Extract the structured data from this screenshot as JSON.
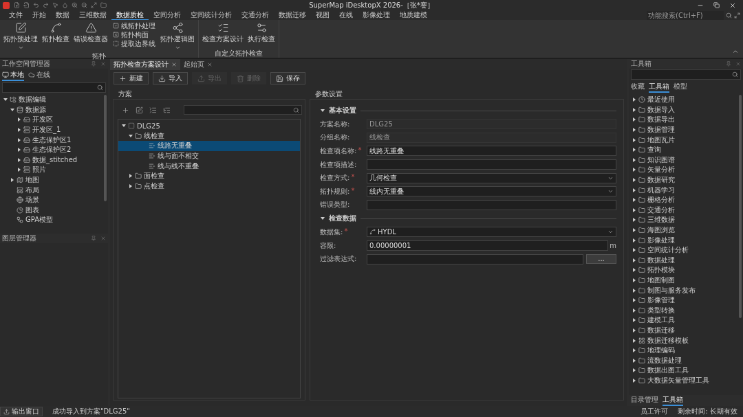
{
  "window": {
    "title": "SuperMap iDesktopX 2026-［张*謇］",
    "search_placeholder": "功能搜索(Ctrl+F)"
  },
  "menu": [
    {
      "label": "文件",
      "selected": false
    },
    {
      "label": "开始",
      "selected": false
    },
    {
      "label": "数据",
      "selected": false
    },
    {
      "label": "三维数据",
      "selected": false
    },
    {
      "label": "数据质检",
      "selected": true
    },
    {
      "label": "空间分析",
      "selected": false
    },
    {
      "label": "空间统计分析",
      "selected": false
    },
    {
      "label": "交通分析",
      "selected": false
    },
    {
      "label": "数据迁移",
      "selected": false
    },
    {
      "label": "视图",
      "selected": false
    },
    {
      "label": "在线",
      "selected": false
    },
    {
      "label": "影像处理",
      "selected": false
    },
    {
      "label": "地质建模",
      "selected": false
    }
  ],
  "ribbon": {
    "groups": [
      {
        "label": "拓扑",
        "items": [
          {
            "kind": "large",
            "label": "拓扑预处理",
            "dropdown": true
          },
          {
            "kind": "large",
            "label": "拓扑检查",
            "dropdown": false
          },
          {
            "kind": "large",
            "label": "错误检查器",
            "dropdown": false
          },
          {
            "kind": "stack",
            "entries": [
              "线拓扑处理",
              "拓扑构面",
              "提取边界线"
            ]
          },
          {
            "kind": "large",
            "label": "拓扑逻辑图",
            "dropdown": true
          }
        ]
      },
      {
        "label": "自定义拓扑检查",
        "items": [
          {
            "kind": "large",
            "label": "检查方案设计",
            "dropdown": false
          },
          {
            "kind": "large",
            "label": "执行检查",
            "dropdown": false
          }
        ]
      }
    ]
  },
  "workspace_manager": {
    "title": "工作空间管理器",
    "tabs": [
      {
        "label": "本地",
        "selected": true
      },
      {
        "label": "在线",
        "selected": false
      }
    ],
    "tree": [
      {
        "label": "数据编辑",
        "kind": "workspace",
        "expanded": true,
        "children": [
          {
            "label": "数据源",
            "kind": "datasources",
            "expanded": true,
            "children": [
              {
                "label": "开发区",
                "kind": "datasource",
                "expanded": false
              },
              {
                "label": "开发区_1",
                "kind": "db",
                "expanded": false
              },
              {
                "label": "生态保护区1",
                "kind": "datasource",
                "expanded": false
              },
              {
                "label": "生态保护区2",
                "kind": "datasource",
                "expanded": false
              },
              {
                "label": "数据_stitched",
                "kind": "datasource",
                "expanded": false
              },
              {
                "label": "照片",
                "kind": "db",
                "expanded": false
              }
            ]
          },
          {
            "label": "地图",
            "kind": "map",
            "expanded": false
          },
          {
            "label": "布局",
            "kind": "layout"
          },
          {
            "label": "场景",
            "kind": "scene"
          },
          {
            "label": "图表",
            "kind": "chart"
          },
          {
            "label": "GPA模型",
            "kind": "model"
          }
        ]
      }
    ]
  },
  "layer_manager": {
    "title": "图层管理器"
  },
  "doc_tabs": [
    {
      "label": "拓扑检查方案设计",
      "selected": true
    },
    {
      "label": "起始页",
      "selected": false
    }
  ],
  "toolbar": [
    {
      "label": "新建",
      "disabled": false
    },
    {
      "label": "导入",
      "disabled": false
    },
    {
      "label": "导出",
      "disabled": true
    },
    {
      "label": "删除",
      "disabled": true
    },
    {
      "label": "保存",
      "disabled": false
    }
  ],
  "scheme": {
    "title": "方案",
    "tree": [
      {
        "label": "DLG25",
        "kind": "scheme",
        "expanded": true,
        "selected": false,
        "children": [
          {
            "label": "线检查",
            "kind": "group",
            "expanded": true,
            "selected": false,
            "children": [
              {
                "label": "线路无重叠",
                "kind": "item",
                "selected": true
              },
              {
                "label": "线与面不相交",
                "kind": "item",
                "selected": false
              },
              {
                "label": "线与线不重叠",
                "kind": "item",
                "selected": false
              }
            ]
          },
          {
            "label": "面检查",
            "kind": "group",
            "expanded": false,
            "selected": false
          },
          {
            "label": "点检查",
            "kind": "group",
            "expanded": false,
            "selected": false
          }
        ]
      }
    ]
  },
  "parameters": {
    "title": "参数设置",
    "sections": [
      {
        "title": "基本设置",
        "expanded": true,
        "fields": [
          {
            "label": "方案名称:",
            "kind": "text",
            "value": "DLG25",
            "disabled": true
          },
          {
            "label": "分组名称:",
            "kind": "text",
            "value": "线检查",
            "disabled": true
          },
          {
            "label": "检查项名称:",
            "mark": "*",
            "kind": "text",
            "value": "线路无重叠",
            "disabled": false
          },
          {
            "label": "检查项描述:",
            "kind": "text",
            "disabled": false
          },
          {
            "label": "检查方式:",
            "mark": "*",
            "kind": "select",
            "value": "几何检查",
            "disabled": false
          },
          {
            "label": "拓扑规则:",
            "mark": "*",
            "kind": "select",
            "value": "线内无重叠",
            "disabled": false
          },
          {
            "label": "错误类型:",
            "kind": "text",
            "disabled": false
          }
        ]
      },
      {
        "title": "检查数据",
        "expanded": true,
        "fields": [
          {
            "label": "数据集:",
            "mark": "*",
            "kind": "select",
            "value": "HYDL",
            "disabled": false
          },
          {
            "label": "容限:",
            "kind": "unit",
            "value": "0.00000001",
            "unit": "m",
            "disabled": false
          },
          {
            "label": "过滤表达式:",
            "kind": "browse",
            "button": "...",
            "disabled": false
          }
        ]
      }
    ]
  },
  "toolbox": {
    "title": "工具箱",
    "tabs": [
      {
        "label": "收藏",
        "selected": false
      },
      {
        "label": "工具箱",
        "selected": true
      },
      {
        "label": "模型",
        "selected": false
      }
    ],
    "items": [
      {
        "label": "最近使用",
        "kind": "recent",
        "expanded": false
      },
      {
        "label": "数据导入",
        "kind": "folder",
        "expanded": false
      },
      {
        "label": "数据导出",
        "kind": "folder",
        "expanded": false
      },
      {
        "label": "数据管理",
        "kind": "folder",
        "expanded": false
      },
      {
        "label": "地图瓦片",
        "kind": "folder",
        "expanded": false
      },
      {
        "label": "查询",
        "kind": "folder",
        "expanded": false
      },
      {
        "label": "知识图谱",
        "kind": "folder",
        "expanded": false
      },
      {
        "label": "矢量分析",
        "kind": "folder",
        "expanded": false
      },
      {
        "label": "数据研究",
        "kind": "folder",
        "expanded": false
      },
      {
        "label": "机器学习",
        "kind": "folder",
        "expanded": false
      },
      {
        "label": "栅格分析",
        "kind": "folder",
        "expanded": false
      },
      {
        "label": "交通分析",
        "kind": "folder",
        "expanded": false
      },
      {
        "label": "三维数据",
        "kind": "folder",
        "expanded": false
      },
      {
        "label": "海图浏览",
        "kind": "folder",
        "expanded": false
      },
      {
        "label": "影像处理",
        "kind": "folder",
        "expanded": false
      },
      {
        "label": "空间统计分析",
        "kind": "folder",
        "expanded": false
      },
      {
        "label": "数据处理",
        "kind": "folder",
        "expanded": false
      },
      {
        "label": "拓扑模块",
        "kind": "folder",
        "expanded": false
      },
      {
        "label": "地图制图",
        "kind": "folder",
        "expanded": false
      },
      {
        "label": "制图与服务发布",
        "kind": "folder",
        "expanded": false
      },
      {
        "label": "影像管理",
        "kind": "folder",
        "expanded": false
      },
      {
        "label": "类型转换",
        "kind": "folder",
        "expanded": false
      },
      {
        "label": "建模工具",
        "kind": "folder",
        "expanded": false
      },
      {
        "label": "数据迁移",
        "kind": "folder",
        "expanded": false
      },
      {
        "label": "数据迁移模板",
        "kind": "template",
        "expanded": false
      },
      {
        "label": "地理编码",
        "kind": "folder",
        "expanded": false
      },
      {
        "label": "流数据处理",
        "kind": "folder",
        "expanded": false
      },
      {
        "label": "数据出图工具",
        "kind": "folder",
        "expanded": false
      },
      {
        "label": "大数据矢量管理工具",
        "kind": "folder",
        "expanded": false
      }
    ],
    "bottom_tabs": [
      {
        "label": "目录管理",
        "selected": false
      },
      {
        "label": "工具箱",
        "selected": true
      }
    ]
  },
  "status_bar": {
    "output_tab": "输出窗口",
    "message": "成功导入到方案\"DLG25\"",
    "license": "员工许可",
    "remaining": "剩余时间: 长期有效"
  }
}
